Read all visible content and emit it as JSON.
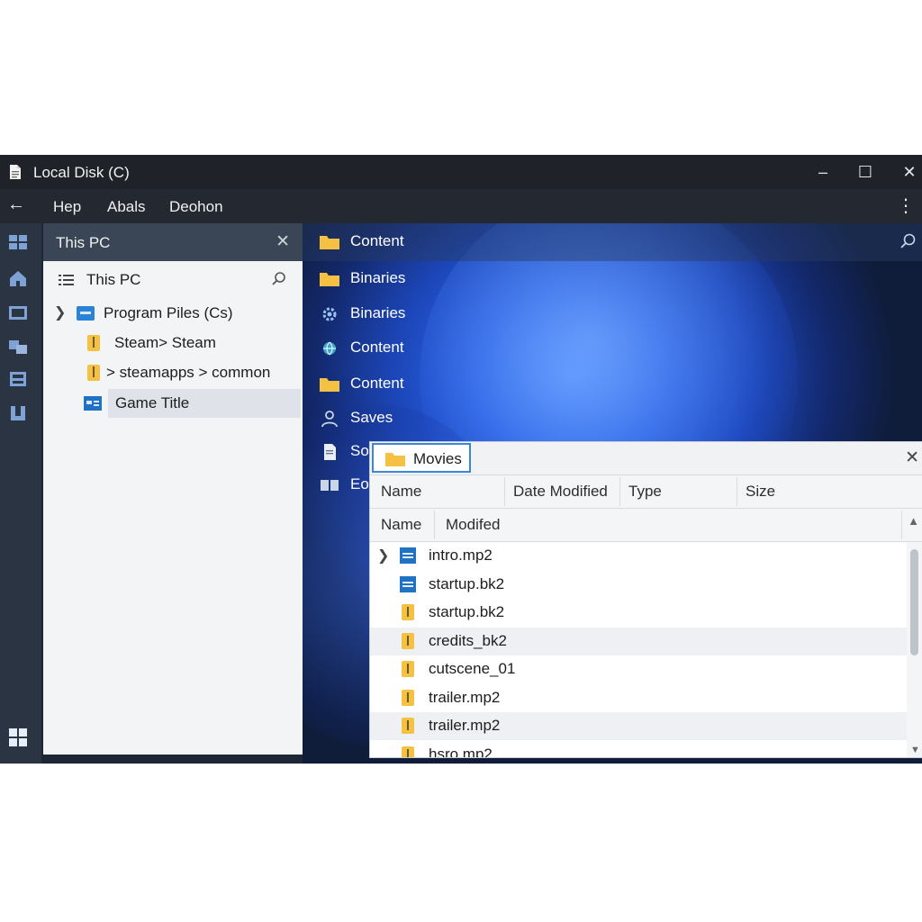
{
  "window": {
    "title": "Local Disk (C)"
  },
  "menu": {
    "items": [
      "Hep",
      "Abals",
      "Deohon"
    ]
  },
  "left_panel": {
    "header": "This PC",
    "tree": [
      {
        "label": "This PC",
        "icon": "list-icon"
      },
      {
        "label": "Program Piles (Cs)",
        "icon": "drive-icon"
      },
      {
        "label": "Steam> Steam",
        "icon": "folder-zip-icon"
      },
      {
        "label": "> steamapps > common",
        "icon": "folder-zip-icon"
      },
      {
        "label": "Game Title",
        "icon": "app-window-icon",
        "selected": true
      }
    ]
  },
  "desktop": {
    "items": [
      {
        "label": "Content",
        "icon": "folder-icon"
      },
      {
        "label": "Binaries",
        "icon": "folder-icon"
      },
      {
        "label": "Binaries",
        "icon": "gear-icon"
      },
      {
        "label": "Content",
        "icon": "globe-icon"
      },
      {
        "label": "Content",
        "icon": "folder-icon"
      },
      {
        "label": "Saves",
        "icon": "user-icon"
      },
      {
        "label": "So",
        "icon": "document-icon"
      },
      {
        "label": "Eo",
        "icon": "book-icon"
      }
    ]
  },
  "file_window": {
    "tab": "Movies",
    "columns": [
      "Name",
      "Date Modified",
      "Type",
      "Size"
    ],
    "sub_columns": [
      "Name",
      "Modifed"
    ],
    "files": [
      {
        "name": "intro.mp2",
        "icon": "video-file-icon",
        "expandable": true
      },
      {
        "name": "startup.bk2",
        "icon": "video-file-icon"
      },
      {
        "name": "startup.bk2",
        "icon": "zip-file-icon"
      },
      {
        "name": "credits_bk2",
        "icon": "zip-file-icon"
      },
      {
        "name": "cutscene_01",
        "icon": "zip-file-icon"
      },
      {
        "name": "trailer.mp2",
        "icon": "zip-file-icon"
      },
      {
        "name": "trailer.mp2",
        "icon": "zip-file-icon"
      },
      {
        "name": "hsro.mp2",
        "icon": "zip-file-icon"
      }
    ]
  },
  "colors": {
    "accent": "#3a87d8",
    "folder": "#f5c142",
    "file_blue": "#1f72c4"
  }
}
